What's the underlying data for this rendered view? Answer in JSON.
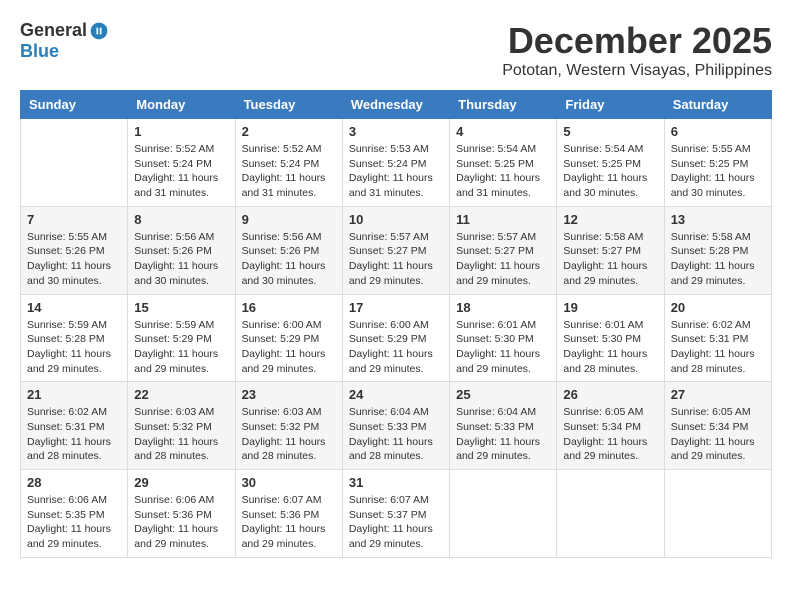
{
  "header": {
    "logo_general": "General",
    "logo_blue": "Blue",
    "month_title": "December 2025",
    "location": "Pototan, Western Visayas, Philippines"
  },
  "calendar": {
    "weekdays": [
      "Sunday",
      "Monday",
      "Tuesday",
      "Wednesday",
      "Thursday",
      "Friday",
      "Saturday"
    ],
    "weeks": [
      [
        {
          "day": "",
          "info": ""
        },
        {
          "day": "1",
          "info": "Sunrise: 5:52 AM\nSunset: 5:24 PM\nDaylight: 11 hours and 31 minutes."
        },
        {
          "day": "2",
          "info": "Sunrise: 5:52 AM\nSunset: 5:24 PM\nDaylight: 11 hours and 31 minutes."
        },
        {
          "day": "3",
          "info": "Sunrise: 5:53 AM\nSunset: 5:24 PM\nDaylight: 11 hours and 31 minutes."
        },
        {
          "day": "4",
          "info": "Sunrise: 5:54 AM\nSunset: 5:25 PM\nDaylight: 11 hours and 31 minutes."
        },
        {
          "day": "5",
          "info": "Sunrise: 5:54 AM\nSunset: 5:25 PM\nDaylight: 11 hours and 30 minutes."
        },
        {
          "day": "6",
          "info": "Sunrise: 5:55 AM\nSunset: 5:25 PM\nDaylight: 11 hours and 30 minutes."
        }
      ],
      [
        {
          "day": "7",
          "info": "Sunrise: 5:55 AM\nSunset: 5:26 PM\nDaylight: 11 hours and 30 minutes."
        },
        {
          "day": "8",
          "info": "Sunrise: 5:56 AM\nSunset: 5:26 PM\nDaylight: 11 hours and 30 minutes."
        },
        {
          "day": "9",
          "info": "Sunrise: 5:56 AM\nSunset: 5:26 PM\nDaylight: 11 hours and 30 minutes."
        },
        {
          "day": "10",
          "info": "Sunrise: 5:57 AM\nSunset: 5:27 PM\nDaylight: 11 hours and 29 minutes."
        },
        {
          "day": "11",
          "info": "Sunrise: 5:57 AM\nSunset: 5:27 PM\nDaylight: 11 hours and 29 minutes."
        },
        {
          "day": "12",
          "info": "Sunrise: 5:58 AM\nSunset: 5:27 PM\nDaylight: 11 hours and 29 minutes."
        },
        {
          "day": "13",
          "info": "Sunrise: 5:58 AM\nSunset: 5:28 PM\nDaylight: 11 hours and 29 minutes."
        }
      ],
      [
        {
          "day": "14",
          "info": "Sunrise: 5:59 AM\nSunset: 5:28 PM\nDaylight: 11 hours and 29 minutes."
        },
        {
          "day": "15",
          "info": "Sunrise: 5:59 AM\nSunset: 5:29 PM\nDaylight: 11 hours and 29 minutes."
        },
        {
          "day": "16",
          "info": "Sunrise: 6:00 AM\nSunset: 5:29 PM\nDaylight: 11 hours and 29 minutes."
        },
        {
          "day": "17",
          "info": "Sunrise: 6:00 AM\nSunset: 5:29 PM\nDaylight: 11 hours and 29 minutes."
        },
        {
          "day": "18",
          "info": "Sunrise: 6:01 AM\nSunset: 5:30 PM\nDaylight: 11 hours and 29 minutes."
        },
        {
          "day": "19",
          "info": "Sunrise: 6:01 AM\nSunset: 5:30 PM\nDaylight: 11 hours and 28 minutes."
        },
        {
          "day": "20",
          "info": "Sunrise: 6:02 AM\nSunset: 5:31 PM\nDaylight: 11 hours and 28 minutes."
        }
      ],
      [
        {
          "day": "21",
          "info": "Sunrise: 6:02 AM\nSunset: 5:31 PM\nDaylight: 11 hours and 28 minutes."
        },
        {
          "day": "22",
          "info": "Sunrise: 6:03 AM\nSunset: 5:32 PM\nDaylight: 11 hours and 28 minutes."
        },
        {
          "day": "23",
          "info": "Sunrise: 6:03 AM\nSunset: 5:32 PM\nDaylight: 11 hours and 28 minutes."
        },
        {
          "day": "24",
          "info": "Sunrise: 6:04 AM\nSunset: 5:33 PM\nDaylight: 11 hours and 28 minutes."
        },
        {
          "day": "25",
          "info": "Sunrise: 6:04 AM\nSunset: 5:33 PM\nDaylight: 11 hours and 29 minutes."
        },
        {
          "day": "26",
          "info": "Sunrise: 6:05 AM\nSunset: 5:34 PM\nDaylight: 11 hours and 29 minutes."
        },
        {
          "day": "27",
          "info": "Sunrise: 6:05 AM\nSunset: 5:34 PM\nDaylight: 11 hours and 29 minutes."
        }
      ],
      [
        {
          "day": "28",
          "info": "Sunrise: 6:06 AM\nSunset: 5:35 PM\nDaylight: 11 hours and 29 minutes."
        },
        {
          "day": "29",
          "info": "Sunrise: 6:06 AM\nSunset: 5:36 PM\nDaylight: 11 hours and 29 minutes."
        },
        {
          "day": "30",
          "info": "Sunrise: 6:07 AM\nSunset: 5:36 PM\nDaylight: 11 hours and 29 minutes."
        },
        {
          "day": "31",
          "info": "Sunrise: 6:07 AM\nSunset: 5:37 PM\nDaylight: 11 hours and 29 minutes."
        },
        {
          "day": "",
          "info": ""
        },
        {
          "day": "",
          "info": ""
        },
        {
          "day": "",
          "info": ""
        }
      ]
    ]
  }
}
